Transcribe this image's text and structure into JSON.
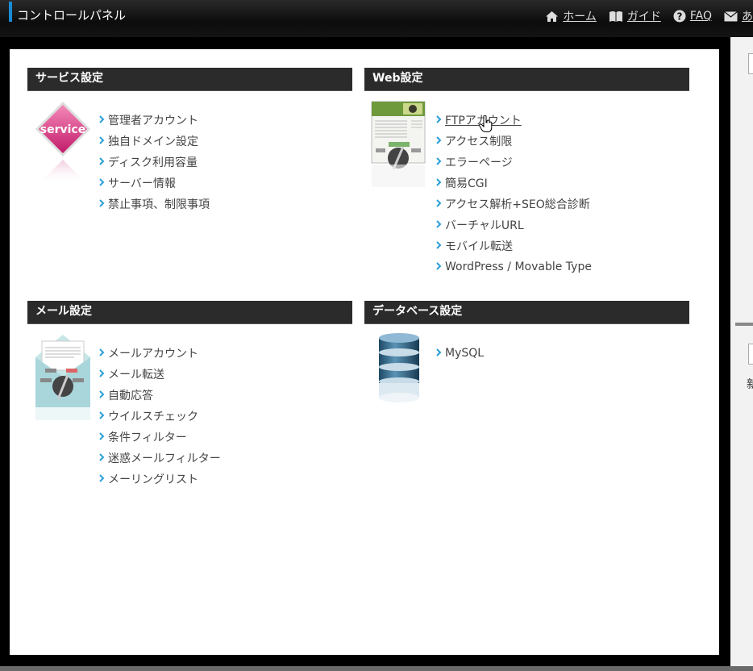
{
  "header": {
    "title": "コントロールパネル",
    "nav": [
      {
        "label": "ホーム",
        "icon": "home-icon"
      },
      {
        "label": "ガイド",
        "icon": "book-icon"
      },
      {
        "label": "FAQ",
        "icon": "question-icon"
      },
      {
        "label": "あ",
        "icon": "mail-icon"
      }
    ]
  },
  "panels": {
    "service": {
      "title": "サービス設定",
      "badge": "service",
      "items": [
        "管理者アカウント",
        "独自ドメイン設定",
        "ディスク利用容量",
        "サーバー情報",
        "禁止事項、制限事項"
      ]
    },
    "web": {
      "title": "Web設定",
      "items": [
        "FTPアカウント",
        "アクセス制限",
        "エラーページ",
        "簡易CGI",
        "アクセス解析+SEO総合診断",
        "バーチャルURL",
        "モバイル転送",
        "WordPress / Movable Type"
      ]
    },
    "mail": {
      "title": "メール設定",
      "items": [
        "メールアカウント",
        "メール転送",
        "自動応答",
        "ウイルスチェック",
        "条件フィルター",
        "迷惑メールフィルター",
        "メーリングリスト"
      ]
    },
    "database": {
      "title": "データベース設定",
      "items": [
        "MySQL"
      ]
    }
  },
  "right_strip": {
    "text": "新"
  },
  "colors": {
    "accent": "#1a8bd6",
    "header_bg": "#2b2b2b",
    "chevron": "#2a9fd8"
  }
}
